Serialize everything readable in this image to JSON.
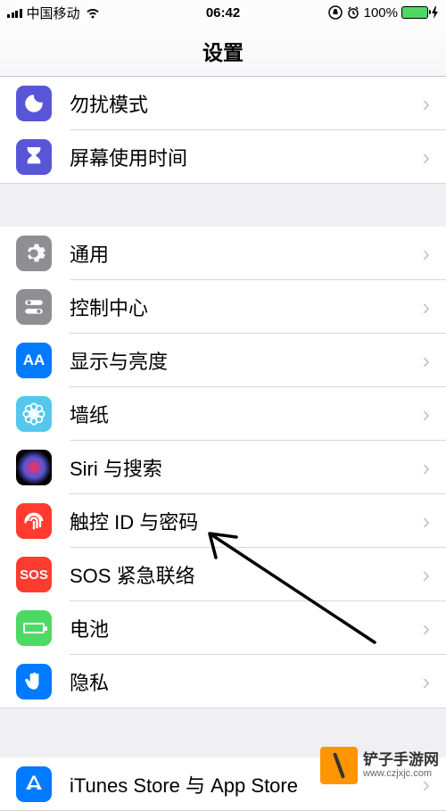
{
  "status": {
    "carrier": "中国移动",
    "time": "06:42",
    "battery_pct": "100%"
  },
  "header": {
    "title": "设置"
  },
  "group1": [
    {
      "label": "勿扰模式",
      "icon": "dnd"
    },
    {
      "label": "屏幕使用时间",
      "icon": "screentime"
    }
  ],
  "group2": [
    {
      "label": "通用",
      "icon": "general"
    },
    {
      "label": "控制中心",
      "icon": "control"
    },
    {
      "label": "显示与亮度",
      "icon": "display",
      "badge": "AA"
    },
    {
      "label": "墙纸",
      "icon": "wallpaper"
    },
    {
      "label": "Siri 与搜索",
      "icon": "siri"
    },
    {
      "label": "触控 ID 与密码",
      "icon": "touchid"
    },
    {
      "label": "SOS 紧急联络",
      "icon": "sos",
      "badge": "SOS"
    },
    {
      "label": "电池",
      "icon": "battery"
    },
    {
      "label": "隐私",
      "icon": "privacy"
    }
  ],
  "group3": [
    {
      "label": "iTunes Store 与 App Store",
      "icon": "appstore"
    }
  ],
  "watermark": {
    "name": "铲子手游网",
    "url": "www.czjxjc.com"
  }
}
